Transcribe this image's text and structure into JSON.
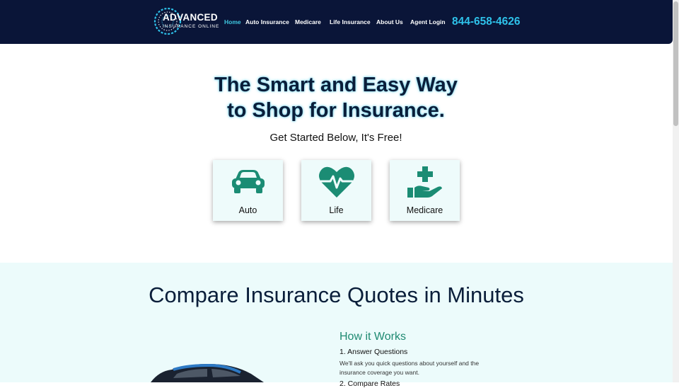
{
  "header": {
    "logo": {
      "line1": "ADVANCED",
      "line2": "INSURANCE ONLINE"
    },
    "nav": [
      {
        "label": "Home",
        "active": true
      },
      {
        "label": "Auto Insurance"
      },
      {
        "label": "Medicare"
      },
      {
        "label": "Life Insurance"
      },
      {
        "label": "About Us"
      },
      {
        "label": "Agent Login"
      }
    ],
    "phone": "844-658-4626"
  },
  "hero": {
    "title_line1": "The Smart and Easy Way",
    "title_line2": "to Shop for Insurance.",
    "subtitle": "Get Started Below, It's Free!"
  },
  "cards": [
    {
      "label": "Auto",
      "icon": "car-icon"
    },
    {
      "label": "Life",
      "icon": "heart-pulse-icon"
    },
    {
      "label": "Medicare",
      "icon": "medical-hand-icon"
    }
  ],
  "compare": {
    "title": "Compare Insurance Quotes in Minutes",
    "how_title": "How it Works",
    "steps": [
      {
        "title": "1. Answer Questions",
        "desc": "We'll ask you quick questions about yourself and the insurance coverage you want."
      },
      {
        "title": "2. Compare Rates"
      }
    ]
  },
  "colors": {
    "navy": "#0a1538",
    "accent": "#2ec2ea",
    "teal": "#1f8a72",
    "section_bg": "#ecfbfb"
  }
}
